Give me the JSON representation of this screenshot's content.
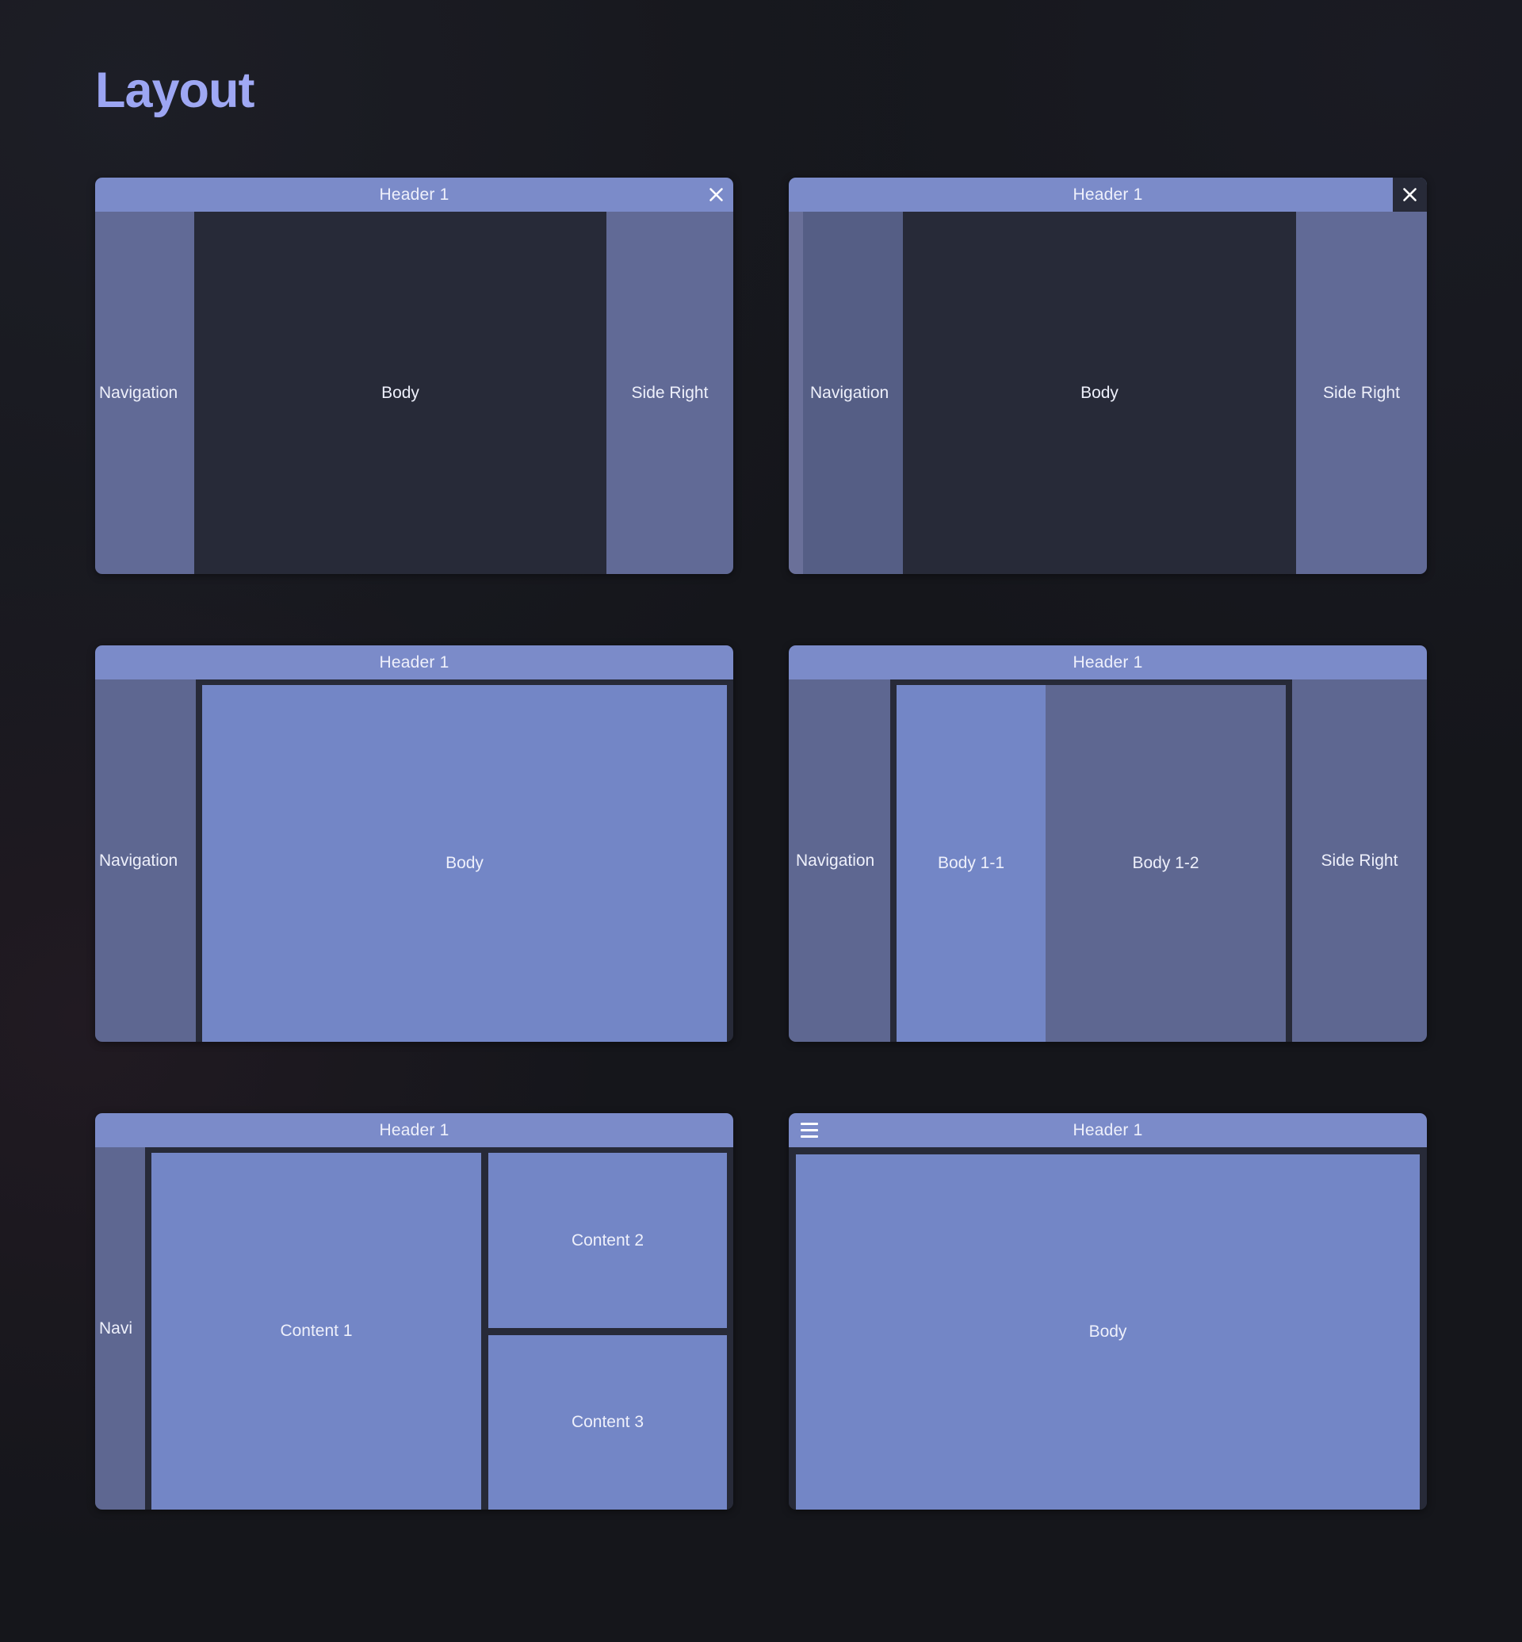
{
  "page": {
    "title": "Layout",
    "background_color": "#15161b",
    "accent_color": "#aab2f5"
  },
  "palette": {
    "header": "#7b8bc9",
    "navigation": "#616a96",
    "navigation_dark": "#555e85",
    "body_dark": "#272a38",
    "body_light": "#7386c6",
    "body_mid": "#5e6791",
    "side_right": "#616a96",
    "text": "#eef0fb"
  },
  "cards": [
    {
      "id": "card-1",
      "header": {
        "title": "Header 1",
        "close_label": "×",
        "has_close": true,
        "has_menu": false
      },
      "panels": {
        "navigation": "Navigation",
        "body": "Body",
        "side_right": "Side Right"
      }
    },
    {
      "id": "card-2",
      "header": {
        "title": "Header 1",
        "close_label": "×",
        "has_close": true,
        "has_menu": false
      },
      "panels": {
        "navigation": "Navigation",
        "body": "Body",
        "side_right": "Side Right"
      }
    },
    {
      "id": "card-3",
      "header": {
        "title": "Header 1",
        "has_close": false,
        "has_menu": false
      },
      "panels": {
        "navigation": "Navigation",
        "body": "Body"
      }
    },
    {
      "id": "card-4",
      "header": {
        "title": "Header 1",
        "has_close": false,
        "has_menu": false
      },
      "panels": {
        "navigation": "Navigation",
        "body_1_1": "Body 1-1",
        "body_1_2": "Body 1-2",
        "side_right": "Side Right"
      }
    },
    {
      "id": "card-5",
      "header": {
        "title": "Header 1",
        "has_close": false,
        "has_menu": false
      },
      "panels": {
        "navigation": "Navi",
        "content_1": "Content 1",
        "content_2": "Content 2",
        "content_3": "Content 3"
      }
    },
    {
      "id": "card-6",
      "header": {
        "title": "Header 1",
        "has_close": false,
        "has_menu": true,
        "menu_label": "menu-icon"
      },
      "panels": {
        "body": "Body"
      }
    }
  ]
}
